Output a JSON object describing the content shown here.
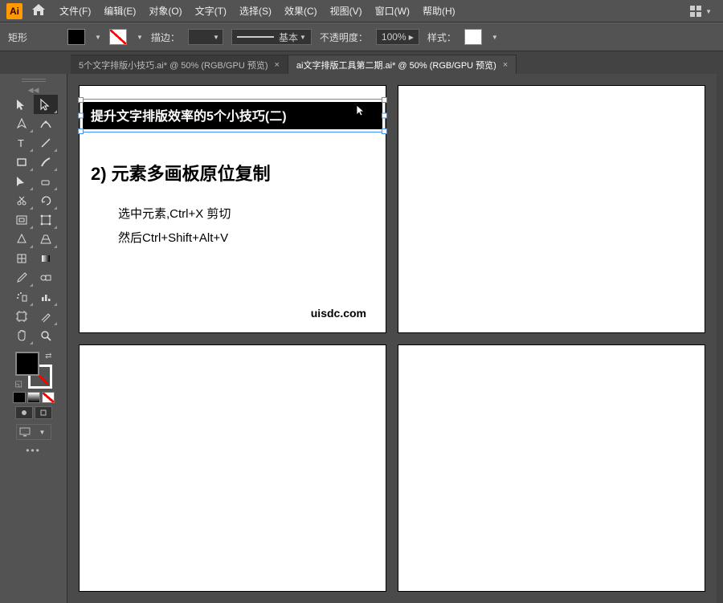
{
  "app": {
    "logo": "Ai"
  },
  "menu": [
    "文件(F)",
    "编辑(E)",
    "对象(O)",
    "文字(T)",
    "选择(S)",
    "效果(C)",
    "视图(V)",
    "窗口(W)",
    "帮助(H)"
  ],
  "optionbar": {
    "shape_label": "矩形",
    "stroke_label": "描边：",
    "stroke_weight": "",
    "uniform_label": "基本",
    "opacity_label": "不透明度：",
    "opacity_value": "100%",
    "style_label": "样式："
  },
  "tabs": [
    {
      "label": "5个文字排版小技巧.ai* @ 50% (RGB/GPU 预览)",
      "active": false
    },
    {
      "label": "ai文字排版工具第二期.ai* @ 50% (RGB/GPU 预览)",
      "active": true
    }
  ],
  "artboard1": {
    "selected_text": "提升文字排版效率的5个小技巧(二)",
    "heading": "2) 元素多画板原位复制",
    "line1": "选中元素,Ctrl+X 剪切",
    "line2": "然后Ctrl+Shift+Alt+V",
    "credit": "uisdc.com"
  },
  "tool_names": [
    "selection-tool",
    "direct-selection-tool",
    "pen-tool",
    "curvature-tool",
    "type-tool",
    "line-tool",
    "rectangle-tool",
    "paintbrush-tool",
    "shaper-tool",
    "eraser-tool",
    "scissors-tool",
    "rotate-tool",
    "width-tool",
    "free-transform-tool",
    "shape-builder-tool",
    "perspective-tool",
    "mesh-tool",
    "gradient-tool",
    "eyedropper-tool",
    "blend-tool",
    "symbol-sprayer-tool",
    "column-graph-tool",
    "artboard-tool",
    "slice-tool",
    "hand-tool",
    "zoom-tool"
  ]
}
